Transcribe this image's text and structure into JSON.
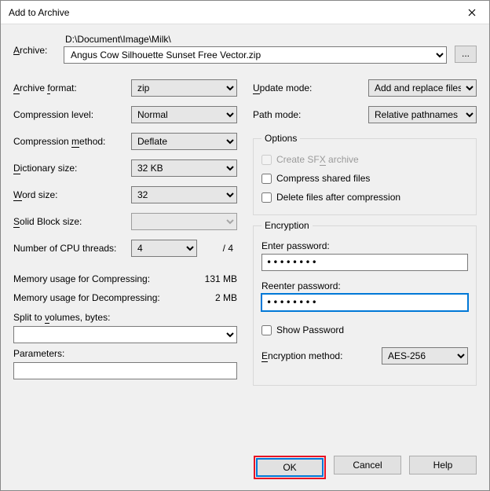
{
  "window": {
    "title": "Add to Archive"
  },
  "archive": {
    "label": "Archive:",
    "path": "D:\\Document\\Image\\Milk\\",
    "filename": "Angus Cow Silhouette Sunset Free Vector.zip",
    "browse": "..."
  },
  "left": {
    "format_label": "Archive format:",
    "format_value": "zip",
    "level_label": "Compression level:",
    "level_value": "Normal",
    "method_label": "Compression method:",
    "method_value": "Deflate",
    "dict_label": "Dictionary size:",
    "dict_value": "32 KB",
    "word_label": "Word size:",
    "word_value": "32",
    "solid_label": "Solid Block size:",
    "solid_value": "",
    "cpu_label": "Number of CPU threads:",
    "cpu_value": "4",
    "cpu_total": "/ 4",
    "mem_compress_label": "Memory usage for Compressing:",
    "mem_compress_value": "131 MB",
    "mem_decompress_label": "Memory usage for Decompressing:",
    "mem_decompress_value": "2 MB",
    "split_label": "Split to volumes, bytes:",
    "params_label": "Parameters:"
  },
  "right": {
    "update_label": "Update mode:",
    "update_value": "Add and replace files",
    "path_label": "Path mode:",
    "path_value": "Relative pathnames",
    "options_legend": "Options",
    "opt_sfx": "Create SFX archive",
    "opt_shared": "Compress shared files",
    "opt_delete": "Delete files after compression",
    "encryption_legend": "Encryption",
    "enter_pw": "Enter password:",
    "reenter_pw": "Reenter password:",
    "pw_masked": "••••••••",
    "show_pw": "Show Password",
    "enc_method_label": "Encryption method:",
    "enc_method_value": "AES-256"
  },
  "buttons": {
    "ok": "OK",
    "cancel": "Cancel",
    "help": "Help"
  }
}
